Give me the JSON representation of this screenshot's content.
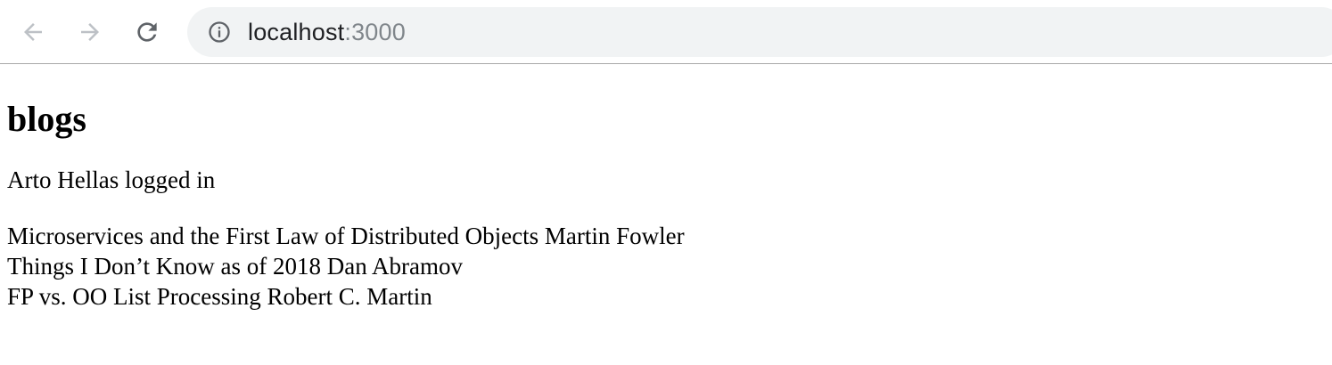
{
  "browser": {
    "url_host": "localhost",
    "url_port": ":3000",
    "icons": {
      "back": "arrow-left-icon",
      "forward": "arrow-right-icon",
      "reload": "reload-icon",
      "site_info": "info-icon"
    }
  },
  "page": {
    "title": "blogs",
    "login_status": "Arto Hellas logged in",
    "blogs": [
      {
        "text": "Microservices and the First Law of Distributed Objects Martin Fowler"
      },
      {
        "text": "Things I Don’t Know as of 2018 Dan Abramov"
      },
      {
        "text": "FP vs. OO List Processing Robert C. Martin"
      }
    ]
  }
}
